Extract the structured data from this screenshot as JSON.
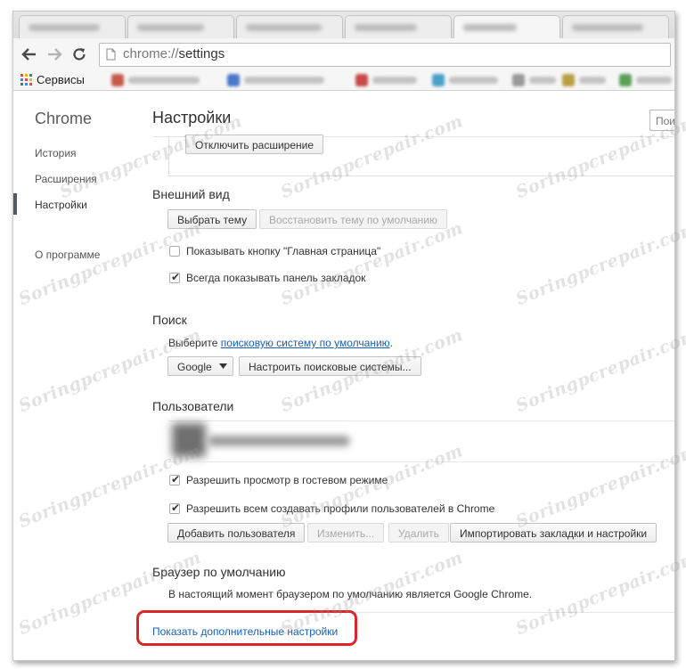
{
  "browser": {
    "url_scheme": "chrome://",
    "url_path": "settings",
    "bookmarks_bar": {
      "apps_label": "Сервисы",
      "blurred_items": [
        {
          "color": "#c75a4a",
          "w": 90
        },
        {
          "color": "#4a79c7",
          "w": 100
        },
        {
          "color": "#c74a4a",
          "w": 60
        },
        {
          "color": "#4aa0c7",
          "w": 70
        },
        {
          "color": "#9a9a9a",
          "w": 40
        },
        {
          "color": "#5aa05a",
          "w": 40
        }
      ]
    }
  },
  "sidebar": {
    "title": "Chrome",
    "items": [
      {
        "label": "История"
      },
      {
        "label": "Расширения"
      },
      {
        "label": "Настройки"
      },
      {
        "label": "О программе"
      }
    ]
  },
  "header": {
    "title": "Настройки",
    "search_placeholder": "Пои"
  },
  "extensions_panel": {
    "disable_button": "Отключить расширение"
  },
  "appearance": {
    "title": "Внешний вид",
    "choose_theme": "Выбрать тему",
    "reset_theme": "Восстановить тему по умолчанию",
    "show_home_button": "Показывать кнопку \"Главная страница\"",
    "show_home_checked": false,
    "always_show_bookmarks": "Всегда показывать панель закладок",
    "always_show_bookmarks_checked": true
  },
  "search": {
    "title": "Поиск",
    "text_prefix": "Выберите ",
    "text_link": "поисковую систему по умолчанию",
    "text_suffix": ".",
    "engine_select": "Google",
    "manage_engines": "Настроить поисковые системы..."
  },
  "users": {
    "title": "Пользователи",
    "allow_guest": "Разрешить просмотр в гостевом режиме",
    "allow_guest_checked": true,
    "allow_profiles": "Разрешить всем создавать профили пользователей в Chrome",
    "allow_profiles_checked": true,
    "add_user": "Добавить пользователя",
    "edit": "Изменить...",
    "delete": "Удалить",
    "import": "Импортировать закладки и настройки"
  },
  "default_browser": {
    "title": "Браузер по умолчанию",
    "status": "В настоящий момент браузером по умолчанию является Google Chrome."
  },
  "show_advanced": "Показать дополнительные настройки",
  "watermark": "Soringpcrepair.com",
  "colors": {
    "link": "#1a5fb4",
    "highlight": "#d9262b"
  }
}
